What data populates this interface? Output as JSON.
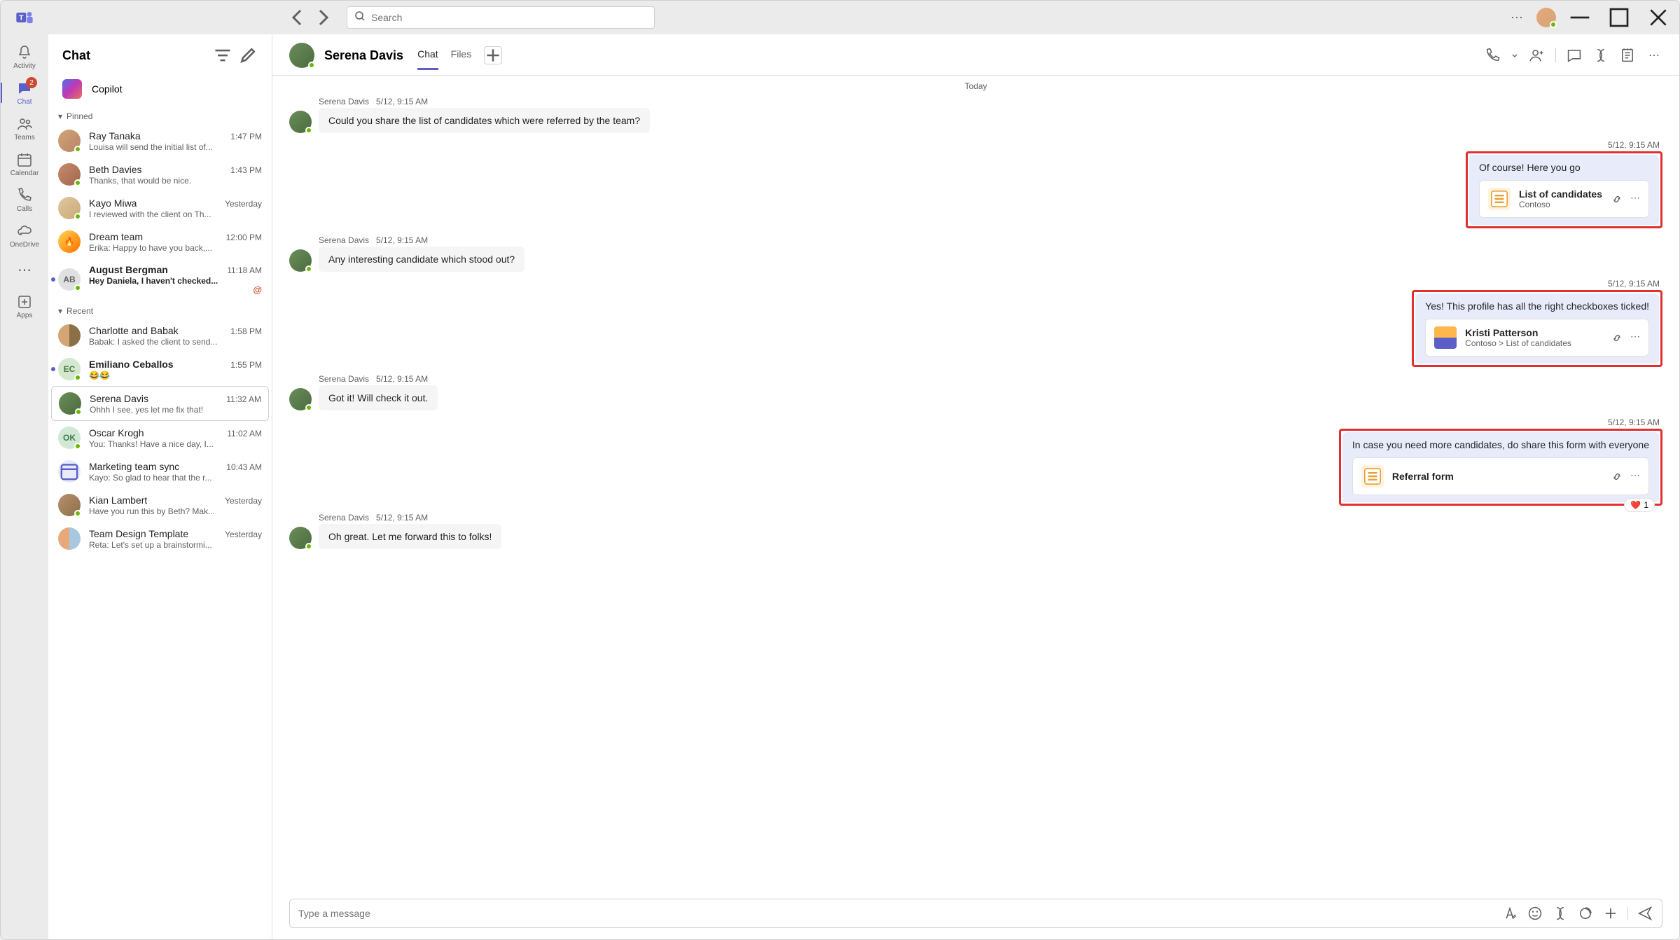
{
  "titlebar": {
    "search_placeholder": "Search"
  },
  "rail": {
    "activity": "Activity",
    "chat": "Chat",
    "chat_badge": "2",
    "teams": "Teams",
    "calendar": "Calendar",
    "calls": "Calls",
    "onedrive": "OneDrive",
    "apps": "Apps"
  },
  "chatlist": {
    "title": "Chat",
    "copilot": "Copilot",
    "pinned_label": "Pinned",
    "recent_label": "Recent",
    "pinned": [
      {
        "name": "Ray Tanaka",
        "preview": "Louisa will send the initial list of...",
        "time": "1:47 PM",
        "bold": false,
        "unread": false,
        "avatar": "av-ray",
        "presence": true
      },
      {
        "name": "Beth Davies",
        "preview": "Thanks, that would be nice.",
        "time": "1:43 PM",
        "bold": false,
        "unread": false,
        "avatar": "av-beth",
        "presence": true
      },
      {
        "name": "Kayo Miwa",
        "preview": "I reviewed with the client on Th...",
        "time": "Yesterday",
        "bold": false,
        "unread": false,
        "avatar": "av-kayo",
        "presence": true
      },
      {
        "name": "Dream team",
        "preview": "Erika: Happy to have you back,...",
        "time": "12:00 PM",
        "bold": false,
        "unread": false,
        "avatar": "av-fire",
        "presence": false,
        "emoji": "🔥"
      },
      {
        "name": "August Bergman",
        "preview": "Hey Daniela, I haven't checked...",
        "time": "11:18 AM",
        "bold": true,
        "unread": true,
        "avatar": "av-ab",
        "presence": true,
        "initials": "AB",
        "mention": "@"
      }
    ],
    "recent": [
      {
        "name": "Charlotte and Babak",
        "preview": "Babak: I asked the client to send...",
        "time": "1:58 PM",
        "bold": false,
        "unread": false,
        "avatar": "av-pair",
        "presence": false
      },
      {
        "name": "Emiliano Ceballos",
        "preview": "😂😂",
        "time": "1:55 PM",
        "bold": true,
        "unread": true,
        "avatar": "av-ec",
        "presence": true,
        "initials": "EC"
      },
      {
        "name": "Serena Davis",
        "preview": "Ohhh I see, yes let me fix that!",
        "time": "11:32 AM",
        "bold": false,
        "unread": false,
        "avatar": "av-serena",
        "presence": true,
        "selected": true
      },
      {
        "name": "Oscar Krogh",
        "preview": "You: Thanks! Have a nice day, I...",
        "time": "11:02 AM",
        "bold": false,
        "unread": false,
        "avatar": "av-ok",
        "presence": true,
        "initials": "OK"
      },
      {
        "name": "Marketing team sync",
        "preview": "Kayo: So glad to hear that the r...",
        "time": "10:43 AM",
        "bold": false,
        "unread": false,
        "avatar": "av-cal",
        "presence": false,
        "icon": "cal"
      },
      {
        "name": "Kian Lambert",
        "preview": "Have you run this by Beth? Mak...",
        "time": "Yesterday",
        "bold": false,
        "unread": false,
        "avatar": "av-kian",
        "presence": true
      },
      {
        "name": "Team Design Template",
        "preview": "Reta: Let's set up a brainstormi...",
        "time": "Yesterday",
        "bold": false,
        "unread": false,
        "avatar": "av-team",
        "presence": false
      }
    ]
  },
  "conv": {
    "title": "Serena Davis",
    "tabs": {
      "chat": "Chat",
      "files": "Files"
    },
    "day": "Today",
    "compose_placeholder": "Type a message",
    "messages": [
      {
        "side": "other",
        "author": "Serena Davis",
        "time": "5/12, 9:15 AM",
        "text": "Could you share the list of candidates which were referred by the team?"
      },
      {
        "side": "mine",
        "time": "5/12, 9:15 AM",
        "text": "Of course! Here you go",
        "hl": true,
        "card": {
          "title": "List of candidates",
          "sub": "Contoso",
          "icon": "list"
        }
      },
      {
        "side": "other",
        "author": "Serena Davis",
        "time": "5/12, 9:15 AM",
        "text": "Any interesting candidate which stood out?"
      },
      {
        "side": "mine",
        "time": "5/12, 9:15 AM",
        "text": "Yes! This profile has all the right checkboxes ticked!",
        "hl": true,
        "card": {
          "title": "Kristi Patterson",
          "sub": "Contoso > List of candidates",
          "icon": "profile"
        }
      },
      {
        "side": "other",
        "author": "Serena Davis",
        "time": "5/12, 9:15 AM",
        "text": "Got it! Will check it out."
      },
      {
        "side": "mine",
        "time": "5/12, 9:15 AM",
        "text": "In case you need more candidates, do share this form with everyone",
        "hl": true,
        "card": {
          "title": "Referral form",
          "sub": "",
          "icon": "list"
        },
        "reaction": {
          "emoji": "❤️",
          "count": "1"
        }
      },
      {
        "side": "other",
        "author": "Serena Davis",
        "time": "5/12, 9:15 AM",
        "text": "Oh great. Let me forward this to folks!"
      }
    ]
  }
}
